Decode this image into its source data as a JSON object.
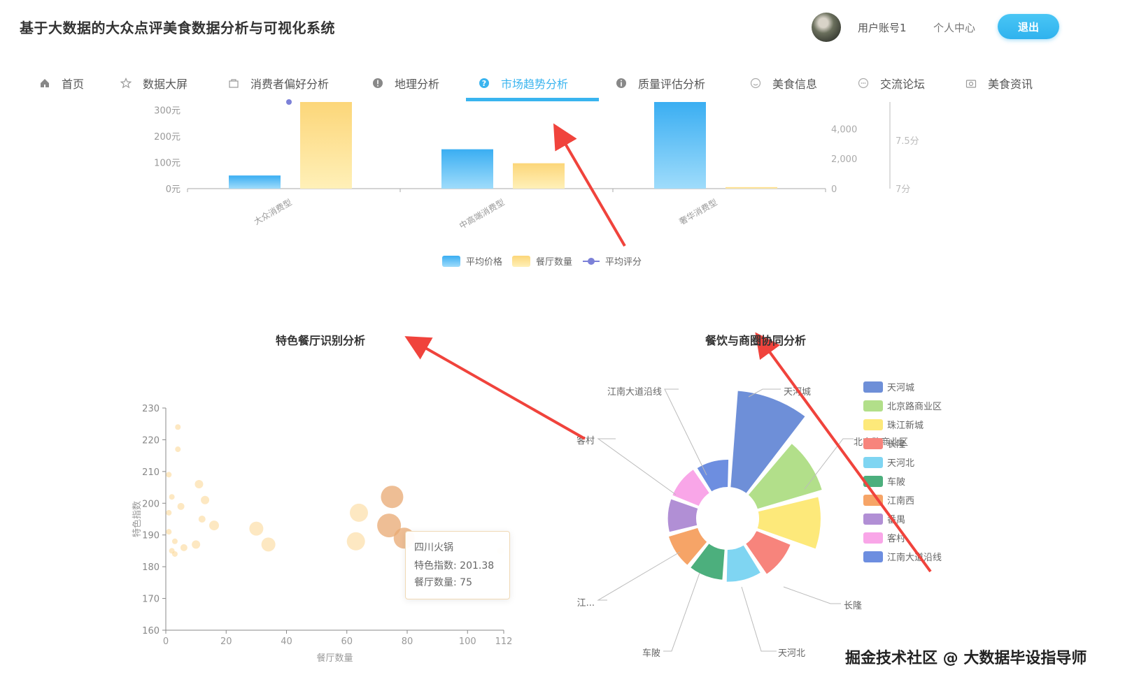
{
  "app": {
    "title": "基于大数据的大众点评美食数据分析与可视化系统"
  },
  "header": {
    "user_account": "用户账号1",
    "personal_center": "个人中心",
    "logout": "退出"
  },
  "nav": {
    "items": [
      {
        "label": "首页",
        "icon": "home-icon"
      },
      {
        "label": "数据大屏",
        "icon": "star-icon"
      },
      {
        "label": "消费者偏好分析",
        "icon": "bag-icon"
      },
      {
        "label": "地理分析",
        "icon": "alert-icon"
      },
      {
        "label": "市场趋势分析",
        "icon": "question-icon",
        "active": true
      },
      {
        "label": "质量评估分析",
        "icon": "info-icon"
      },
      {
        "label": "美食信息",
        "icon": "smile-icon"
      },
      {
        "label": "交流论坛",
        "icon": "chat-icon"
      },
      {
        "label": "美食资讯",
        "icon": "camera-icon"
      }
    ],
    "accent_color": "#39b4ef"
  },
  "charts": {
    "top": {
      "left_axis_ticks": [
        "0元",
        "100元",
        "200元",
        "300元"
      ],
      "middle_axis_ticks": [
        "0",
        "2,000",
        "4,000"
      ],
      "right_axis_ticks": [
        "7分",
        "7.5分"
      ],
      "legend": [
        "平均价格",
        "餐厅数量",
        "平均评分"
      ]
    },
    "scatter_title": "特色餐厅识别分析",
    "rose_title": "餐饮与商圈协同分析",
    "tooltip": {
      "name": "四川火锅",
      "line1": "特色指数: 201.38",
      "line2": "餐厅数量: 75"
    }
  },
  "chart_data": [
    {
      "type": "bar",
      "categories": [
        "大众消费型",
        "中高端消费型",
        "奢华消费型"
      ],
      "series": [
        {
          "name": "平均价格",
          "axis": "left",
          "values": [
            50,
            150,
            360
          ],
          "color": "#3fb1f3"
        },
        {
          "name": "餐厅数量",
          "axis": "middle",
          "values": [
            5800,
            1700,
            100
          ],
          "color": "#fcd97e"
        },
        {
          "name": "平均评分",
          "axis": "right",
          "values": [
            7.9,
            null,
            null
          ],
          "color": "#7c81d8"
        }
      ],
      "ylim_left": [
        0,
        330
      ],
      "ylim_middle": [
        0,
        5800
      ],
      "ylim_right": [
        7,
        7.9
      ],
      "legend_position": "bottom"
    },
    {
      "type": "scatter",
      "title": "特色餐厅识别分析",
      "xlabel": "餐厅数量",
      "ylabel": "特色指数",
      "xlim": [
        0,
        112
      ],
      "ylim": [
        160,
        230
      ],
      "x_ticks": [
        "0",
        "20",
        "40",
        "60",
        "80",
        "100",
        "112"
      ],
      "y_ticks": [
        "160",
        "170",
        "180",
        "190",
        "200",
        "210",
        "220",
        "230"
      ],
      "points": [
        {
          "x": 4,
          "y": 224,
          "size": 4
        },
        {
          "x": 4,
          "y": 217,
          "size": 4
        },
        {
          "x": 1,
          "y": 209,
          "size": 4
        },
        {
          "x": 2,
          "y": 202,
          "size": 4
        },
        {
          "x": 5,
          "y": 199,
          "size": 5
        },
        {
          "x": 1,
          "y": 197,
          "size": 4
        },
        {
          "x": 11,
          "y": 206,
          "size": 6
        },
        {
          "x": 13,
          "y": 201,
          "size": 6
        },
        {
          "x": 12,
          "y": 195,
          "size": 5
        },
        {
          "x": 16,
          "y": 193,
          "size": 7
        },
        {
          "x": 1,
          "y": 191,
          "size": 4
        },
        {
          "x": 3,
          "y": 188,
          "size": 4
        },
        {
          "x": 6,
          "y": 186,
          "size": 5
        },
        {
          "x": 10,
          "y": 187,
          "size": 6
        },
        {
          "x": 2,
          "y": 185,
          "size": 4
        },
        {
          "x": 3,
          "y": 184,
          "size": 4
        },
        {
          "x": 30,
          "y": 192,
          "size": 10
        },
        {
          "x": 34,
          "y": 187,
          "size": 10
        },
        {
          "x": 64,
          "y": 197,
          "size": 13
        },
        {
          "x": 63,
          "y": 188,
          "size": 13
        },
        {
          "x": 75,
          "y": 202,
          "size": 16
        },
        {
          "x": 74,
          "y": 193,
          "size": 17
        },
        {
          "x": 79,
          "y": 189,
          "size": 15
        },
        {
          "x": 111,
          "y": 185,
          "size": 5
        }
      ]
    },
    {
      "type": "pie",
      "subtype": "rose",
      "title": "餐饮与商圈协同分析",
      "legend_position": "right",
      "slices": [
        {
          "name": "天河城",
          "value": 100,
          "color": "#6e8fd8"
        },
        {
          "name": "北京路商业区",
          "value": 68,
          "color": "#b2df8a"
        },
        {
          "name": "珠江新城",
          "value": 62,
          "color": "#fde97a"
        },
        {
          "name": "长隆",
          "value": 35,
          "color": "#f7847c"
        },
        {
          "name": "天河北",
          "value": 30,
          "color": "#7fd5f2"
        },
        {
          "name": "车陂",
          "value": 28,
          "color": "#4caf7d"
        },
        {
          "name": "江南西",
          "value": 28,
          "color": "#f6a467"
        },
        {
          "name": "番禺",
          "value": 26,
          "color": "#b18fd5"
        },
        {
          "name": "客村",
          "value": 26,
          "color": "#f9a6e8"
        },
        {
          "name": "江南大道沿线",
          "value": 25,
          "color": "#6d8ee0"
        }
      ],
      "outer_labels": [
        "天河城",
        "北京路商业区",
        "长隆",
        "天河北",
        "车陂",
        "江...",
        "客村",
        "江南大道沿线"
      ]
    }
  ],
  "watermark": "掘金技术社区 @ 大数据毕设指导师"
}
